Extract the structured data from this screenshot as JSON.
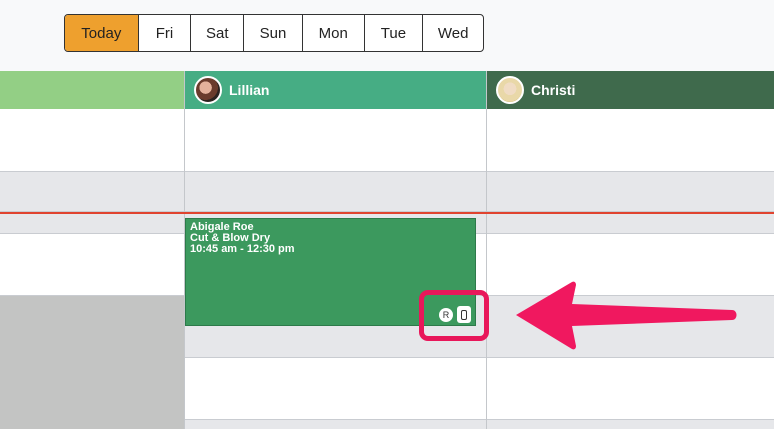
{
  "day_tabs": [
    {
      "label": "Today"
    },
    {
      "label": "Fri"
    },
    {
      "label": "Sat"
    },
    {
      "label": "Sun"
    },
    {
      "label": "Mon"
    },
    {
      "label": "Tue"
    },
    {
      "label": "Wed"
    }
  ],
  "staff": [
    {
      "name": "",
      "color": "#93cf85"
    },
    {
      "name": "Lillian",
      "color": "#46ad84"
    },
    {
      "name": "Christi",
      "color": "#3f6a4c"
    }
  ],
  "appointment": {
    "client": "Abigale Roe",
    "service": "Cut & Blow Dry",
    "time": "10:45 am - 12:30 pm",
    "badge_r": "R",
    "color": "#3c995e"
  },
  "annotation": {
    "highlight_color": "#e8175a",
    "arrow_icon": "left-arrow-icon"
  }
}
